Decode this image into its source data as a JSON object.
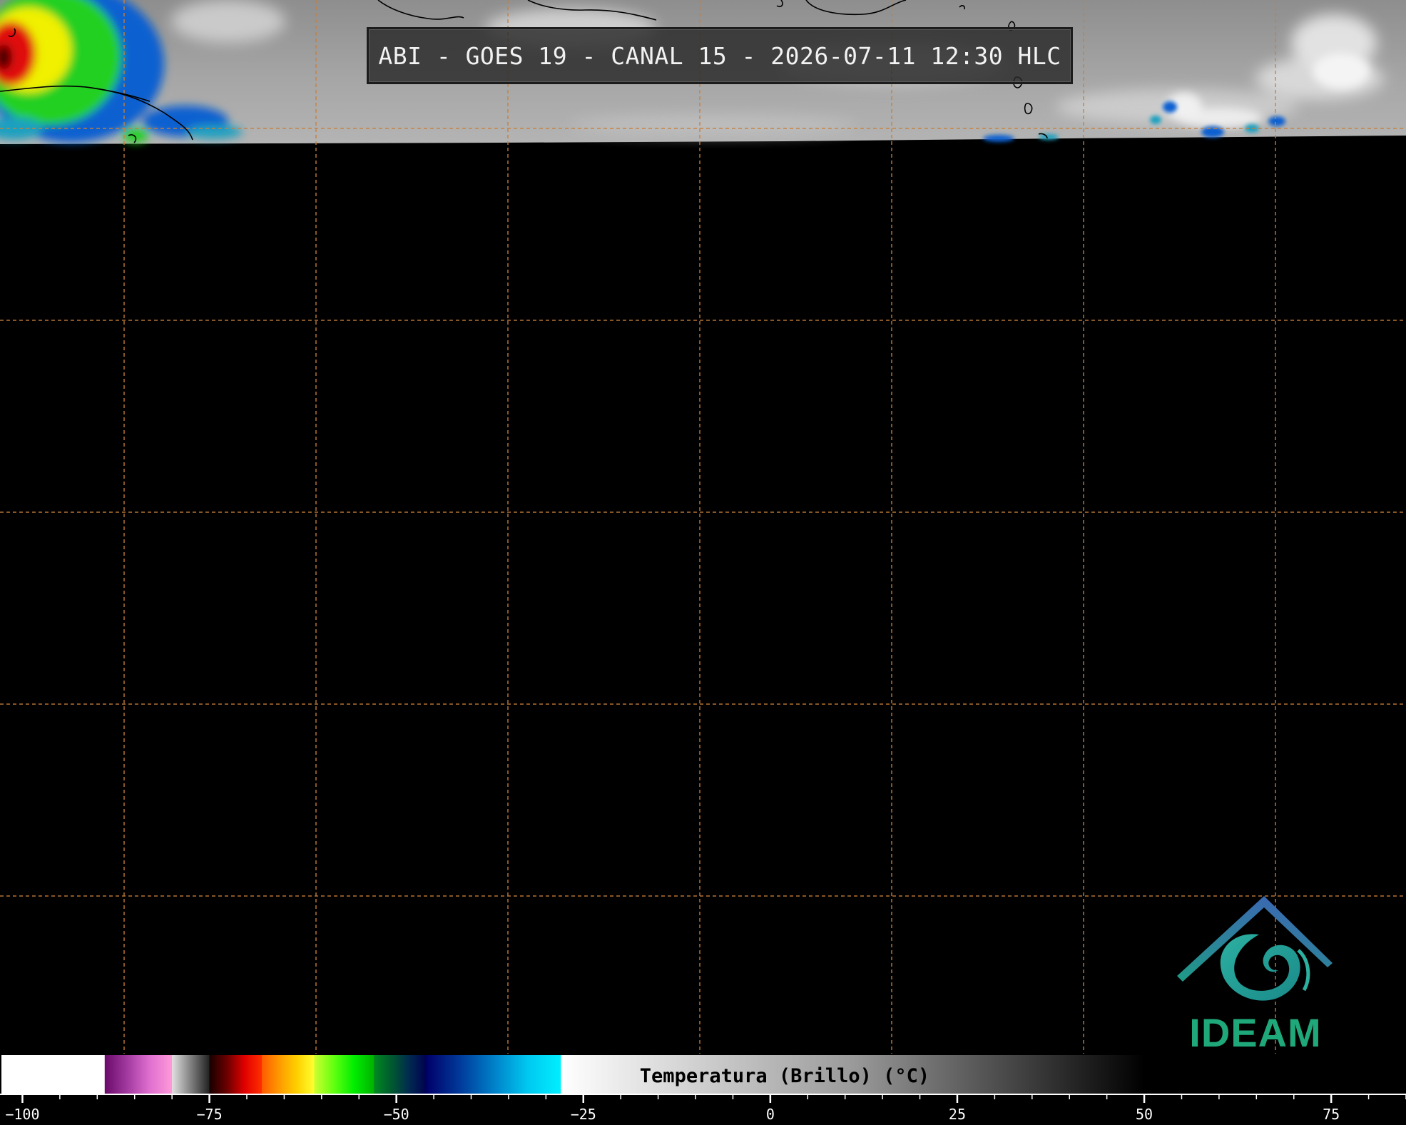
{
  "title": "ABI - GOES 19 - CANAL 15 - 2026-07-11 12:30 HLC",
  "logo": {
    "text": "IDEAM",
    "icon": "ideam-spiral-roof-icon"
  },
  "colorbar": {
    "label": "Temperatura (Brillo) (°C)",
    "min": -103,
    "max": 85,
    "major_ticks": [
      -100,
      -75,
      -50,
      -25,
      0,
      25,
      50,
      75
    ],
    "major_tick_labels": [
      "−100",
      "−75",
      "−50",
      "−25",
      "0",
      "25",
      "50",
      "75"
    ],
    "minor_tick_step": 5,
    "segments": [
      {
        "from": -103,
        "to": -89,
        "colors": [
          "#ffffff",
          "#ffffff"
        ]
      },
      {
        "from": -89,
        "to": -80,
        "colors": [
          "#6a0a6a",
          "#a23aa0",
          "#e070d0",
          "#ff9ad8"
        ]
      },
      {
        "from": -80,
        "to": -75,
        "colors": [
          "#e0e0e0",
          "#808080",
          "#202020"
        ]
      },
      {
        "from": -75,
        "to": -68,
        "colors": [
          "#180000",
          "#6a0000",
          "#e00000",
          "#ff3000"
        ]
      },
      {
        "from": -68,
        "to": -61,
        "colors": [
          "#ff5a00",
          "#ff9a00",
          "#ffd000",
          "#ffff30"
        ]
      },
      {
        "from": -61,
        "to": -53,
        "colors": [
          "#d0ff30",
          "#60ff10",
          "#00ee00",
          "#00b000"
        ]
      },
      {
        "from": -53,
        "to": -46,
        "colors": [
          "#008a20",
          "#005a30",
          "#002a50",
          "#000050"
        ]
      },
      {
        "from": -46,
        "to": -28,
        "colors": [
          "#00006a",
          "#003a9a",
          "#0080c8",
          "#00c8f0",
          "#00f0ff"
        ]
      },
      {
        "from": -28,
        "to": 50,
        "colors": [
          "#ffffff",
          "#9a9a9a",
          "#000000"
        ]
      },
      {
        "from": 50,
        "to": 85,
        "colors": [
          "#000000",
          "#000000"
        ]
      }
    ]
  },
  "map": {
    "background_color": "#000000",
    "grid_color": "#c8803a",
    "imagery_palette": {
      "cloud_light": "#e8e8e8",
      "cloud_gray": "#8a8a8a",
      "cold_cloud_green": "#20d020",
      "cold_cloud_yellow": "#f0f000",
      "cold_cloud_red": "#e01010",
      "cold_cloud_blue": "#1060d0"
    }
  }
}
